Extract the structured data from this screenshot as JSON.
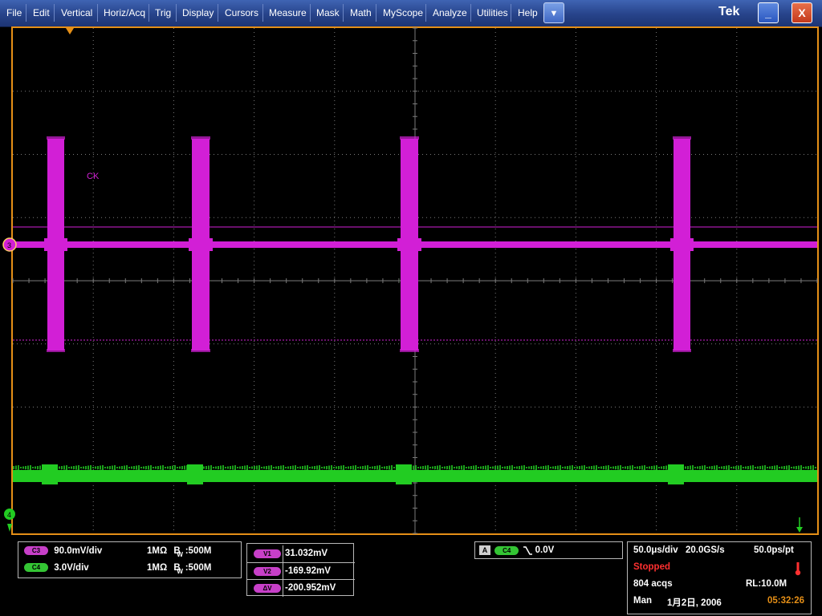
{
  "menu": {
    "items": [
      "File",
      "Edit",
      "Vertical",
      "Horiz/Acq",
      "Trig",
      "Display",
      "Cursors",
      "Measure",
      "Mask",
      "Math",
      "MyScope",
      "Analyze",
      "Utilities",
      "Help"
    ],
    "dropdown_icon": "chevron-down-icon"
  },
  "window": {
    "logo": "Tek",
    "minimize_icon": "minimize-icon",
    "close_icon": "close-icon"
  },
  "display": {
    "waveform_label": "CK",
    "colors": {
      "ch3": "#d21fd6",
      "ch4": "#22cc22",
      "graticule_border": "#e58f17",
      "grid": "#7a7a7a"
    }
  },
  "channels": [
    {
      "pill": "C3",
      "scale": "90.0mV/div",
      "impedance": "1MΩ",
      "bw_symbol": "B",
      "bw_sub": "W",
      "bw": ":500M",
      "color": "#c73fc8"
    },
    {
      "pill": "C4",
      "scale": "3.0V/div",
      "impedance": "1MΩ",
      "bw_symbol": "B",
      "bw_sub": "W",
      "bw": ":500M",
      "color": "#34c534"
    }
  ],
  "cursors": [
    {
      "label": "V1",
      "value": "31.032mV"
    },
    {
      "label": "V2",
      "value": "-169.92mV"
    },
    {
      "label": "ΔV",
      "value": "-200.952mV"
    }
  ],
  "trigger": {
    "mode": "A",
    "source": "C4",
    "slope_icon": "falling-edge-icon",
    "level": "0.0V"
  },
  "acquisition": {
    "timebase": "50.0μs/div",
    "sample_rate": "20.0GS/s",
    "resolution": "50.0ps/pt",
    "status": "Stopped",
    "acqs": "804 acqs",
    "record_length": "RL:10.0M",
    "mode": "Man",
    "date": "1月2日, 2006",
    "time": "05:32:26"
  }
}
